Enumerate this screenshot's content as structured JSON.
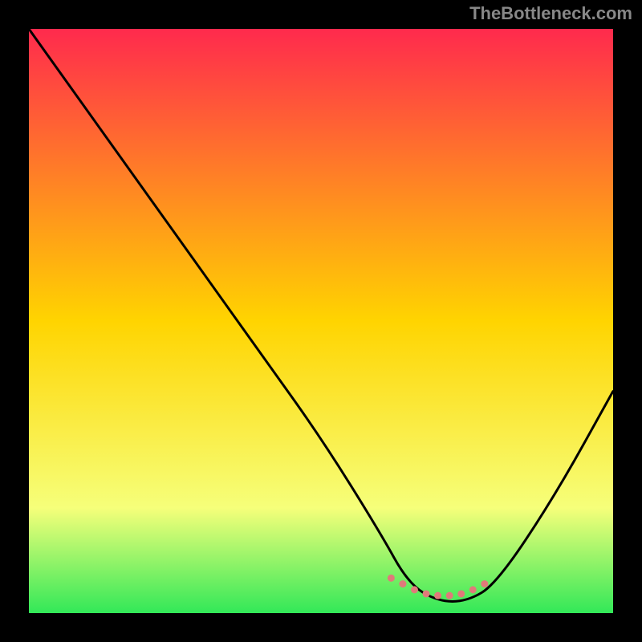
{
  "watermark": "TheBottleneck.com",
  "colors": {
    "grad_top": "#ff2a4d",
    "grad_mid": "#ffd400",
    "grad_low": "#f6ff7a",
    "grad_bottom": "#32e858",
    "curve": "#000000",
    "marker": "#e07a7a",
    "frame_bg": "#000000"
  },
  "chart_data": {
    "type": "line",
    "title": "",
    "xlabel": "",
    "ylabel": "",
    "xlim": [
      0,
      100
    ],
    "ylim": [
      0,
      100
    ],
    "series": [
      {
        "name": "curve",
        "x": [
          0,
          10,
          20,
          30,
          40,
          50,
          60,
          65,
          70,
          75,
          80,
          90,
          100
        ],
        "y": [
          100,
          86,
          72,
          58,
          44,
          30,
          14,
          5,
          2,
          2,
          5,
          20,
          38
        ]
      }
    ],
    "highlight": {
      "x": [
        62,
        64,
        66,
        68,
        70,
        72,
        74,
        76,
        78
      ],
      "y": [
        6,
        5,
        4,
        3.3,
        3,
        3,
        3.3,
        4,
        5
      ]
    }
  }
}
